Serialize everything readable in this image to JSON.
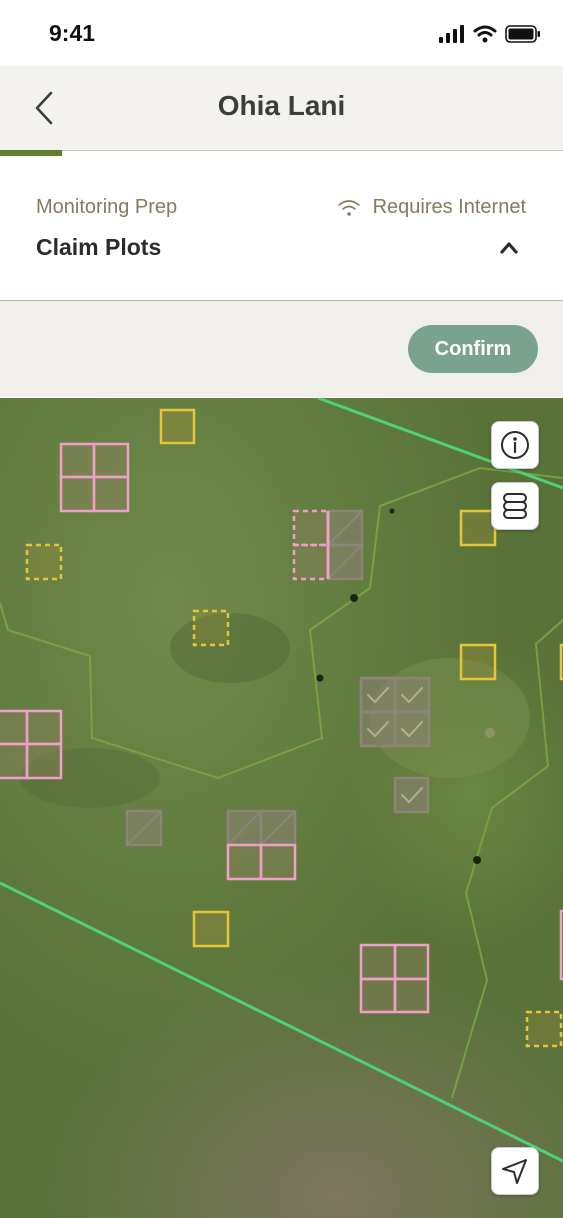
{
  "status_bar": {
    "time": "9:41"
  },
  "header": {
    "title": "Ohia Lani",
    "back_icon": "chevron-left-icon"
  },
  "progress": {
    "fraction": 0.11,
    "color": "#5f7f2f"
  },
  "step": {
    "label": "Monitoring Prep",
    "title": "Claim Plots",
    "internet_note": "Requires Internet",
    "wifi_icon": "wifi-icon",
    "collapse_icon": "chevron-up-icon"
  },
  "actions": {
    "confirm_label": "Confirm",
    "confirm_color": "#7aa38f"
  },
  "map": {
    "info_icon": "info-icon",
    "layers_icon": "layers-icon",
    "locate_icon": "navigation-arrow-icon",
    "colors": {
      "boundary": "#4fd07a",
      "unclaimed": "#e6c53a",
      "claimed": "#f0a0c8",
      "completed": "#8e8478"
    }
  }
}
